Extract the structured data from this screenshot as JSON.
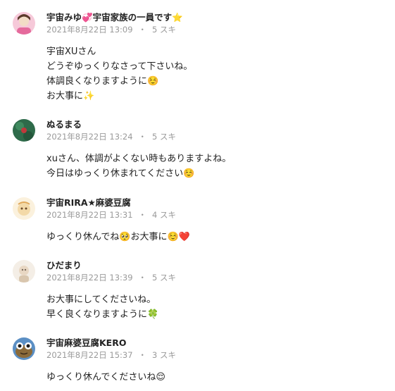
{
  "comments": [
    {
      "name": "宇宙みゆ💞宇宙家族の一員です⭐",
      "date": "2021年8月22日 13:09",
      "dot": "・",
      "likes": "5 スキ",
      "lines": [
        "宇宙XUさん",
        "どうぞゆっくりなさって下さいね。",
        "体調良くなりますように☺️",
        "お大事に✨"
      ],
      "avatar": "avatar-pink-icon"
    },
    {
      "name": "ぬるまる",
      "date": "2021年8月22日 13:24",
      "dot": "・",
      "likes": "5 スキ",
      "lines": [
        "xuさん、体調がよくない時もありますよね。",
        "今日はゆっくり休まれてください☺️"
      ],
      "avatar": "avatar-green-icon"
    },
    {
      "name": "宇宙RIRA★麻婆豆腐",
      "date": "2021年8月22日 13:31",
      "dot": "・",
      "likes": "4 スキ",
      "lines": [
        "ゆっくり休んでね🥺お大事に☺️❤️"
      ],
      "avatar": "avatar-cream-icon"
    },
    {
      "name": "ひだまり",
      "date": "2021年8月22日 13:39",
      "dot": "・",
      "likes": "5 スキ",
      "lines": [
        "お大事にしてくださいね。",
        "早く良くなりますように🍀"
      ],
      "avatar": "avatar-beige-icon"
    },
    {
      "name": "宇宙麻婆豆腐KERO",
      "date": "2021年8月22日 15:37",
      "dot": "・",
      "likes": "3 スキ",
      "lines": [
        "ゆっくり休んでくださいね😌"
      ],
      "avatar": "avatar-frog-icon"
    }
  ]
}
